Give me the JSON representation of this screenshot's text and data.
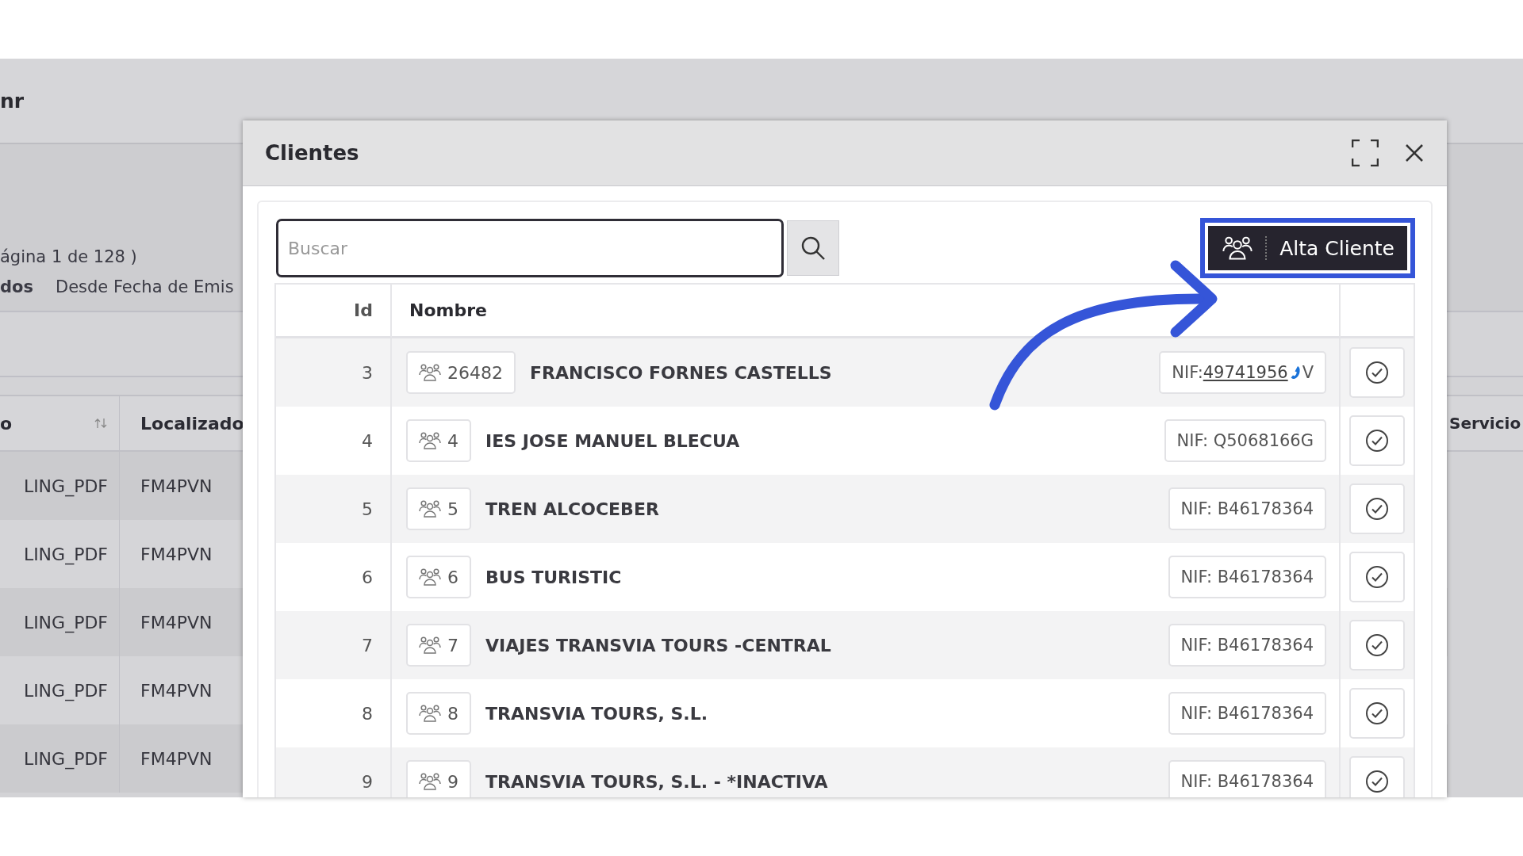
{
  "background": {
    "title": "nr",
    "page_info": "ágina 1 de 128 )",
    "filter_label": "dos",
    "filter_text": "Desde Fecha de Emis",
    "table": {
      "columns": [
        {
          "label": "o",
          "sortable": true
        },
        {
          "label": "Localizado",
          "sortable": false
        },
        {
          "label": "Servicio",
          "sortable": false
        }
      ],
      "rows": [
        [
          "LING_PDF",
          "FM4PVN"
        ],
        [
          "LING_PDF",
          "FM4PVN"
        ],
        [
          "LING_PDF",
          "FM4PVN"
        ],
        [
          "LING_PDF",
          "FM4PVN"
        ],
        [
          "LING_PDF",
          "FM4PVN"
        ]
      ]
    }
  },
  "dialog": {
    "title": "Clientes",
    "search": {
      "placeholder": "Buscar"
    },
    "add_button": {
      "label": "Alta Cliente",
      "highlighted": true
    },
    "columns": [
      "Id",
      "Nombre"
    ],
    "rows": [
      {
        "id": "3",
        "code": "26482",
        "name": "FRANCISCO FORNES CASTELLS",
        "nif_label": "NIF:",
        "nif": "49741956",
        "nif_suffix": "V",
        "linked": true
      },
      {
        "id": "4",
        "code": "4",
        "name": "IES JOSE MANUEL BLECUA",
        "nif_label": "NIF:",
        "nif": "Q5068166G",
        "linked": false
      },
      {
        "id": "5",
        "code": "5",
        "name": "TREN ALCOCEBER",
        "nif_label": "NIF:",
        "nif": "B46178364",
        "linked": false
      },
      {
        "id": "6",
        "code": "6",
        "name": "BUS TURISTIC",
        "nif_label": "NIF:",
        "nif": "B46178364",
        "linked": false
      },
      {
        "id": "7",
        "code": "7",
        "name": "VIAJES TRANSVIA TOURS -CENTRAL",
        "nif_label": "NIF:",
        "nif": "B46178364",
        "linked": false
      },
      {
        "id": "8",
        "code": "8",
        "name": "TRANSVIA TOURS, S.L.",
        "nif_label": "NIF:",
        "nif": "B46178364",
        "linked": false
      },
      {
        "id": "9",
        "code": "9",
        "name": "TRANSVIA TOURS, S.L. - *INACTIVA",
        "nif_label": "NIF:",
        "nif": "B46178364",
        "linked": false
      }
    ]
  }
}
